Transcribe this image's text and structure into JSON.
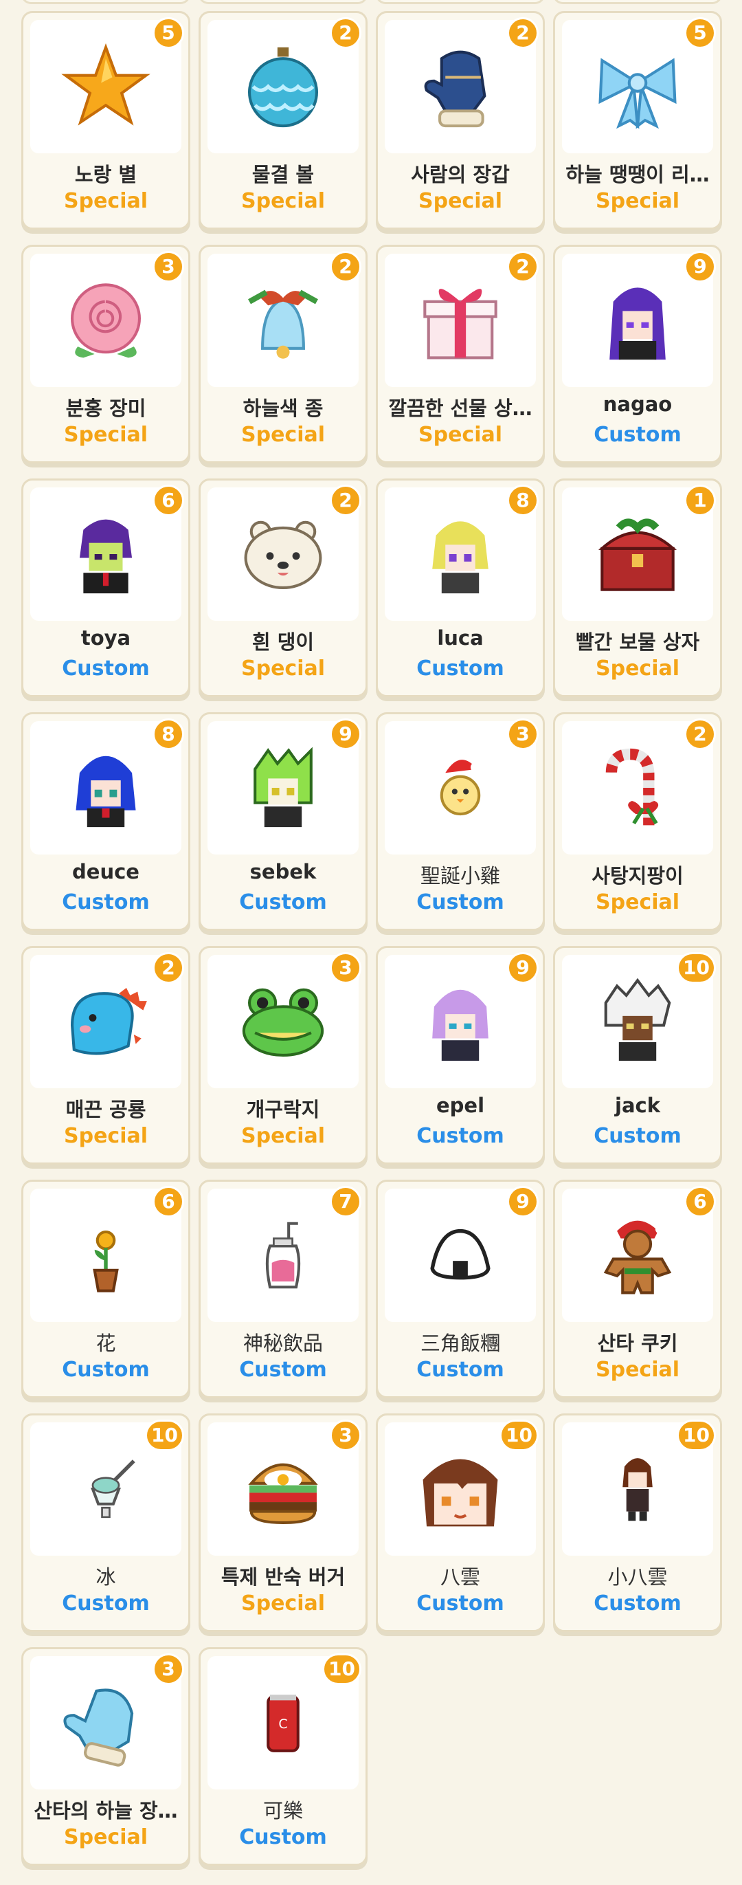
{
  "colors": {
    "special": "#f4a416",
    "custom": "#2a8ee8",
    "badge": "#f4a416",
    "background": "#f8f4e8"
  },
  "items": [
    {
      "name": "노랑 별",
      "type": "Special",
      "count": "5",
      "icon": "yellow-star-icon",
      "light": false
    },
    {
      "name": "물결 볼",
      "type": "Special",
      "count": "2",
      "icon": "blue-ornament-icon",
      "light": false
    },
    {
      "name": "사람의 장갑",
      "type": "Special",
      "count": "2",
      "icon": "blue-mitten-icon",
      "light": false
    },
    {
      "name": "하늘 땡땡이 리…",
      "type": "Special",
      "count": "5",
      "icon": "blue-ribbon-icon",
      "light": false
    },
    {
      "name": "분홍 장미",
      "type": "Special",
      "count": "3",
      "icon": "pink-rose-icon",
      "light": false
    },
    {
      "name": "하늘색 종",
      "type": "Special",
      "count": "2",
      "icon": "sky-bell-icon",
      "light": false
    },
    {
      "name": "깔끔한 선물 상…",
      "type": "Special",
      "count": "2",
      "icon": "gift-box-icon",
      "light": false
    },
    {
      "name": "nagao",
      "type": "Custom",
      "count": "9",
      "icon": "purple-hair-character-icon",
      "light": false
    },
    {
      "name": "toya",
      "type": "Custom",
      "count": "6",
      "icon": "toya-character-icon",
      "light": false
    },
    {
      "name": "흰 댕이",
      "type": "Special",
      "count": "2",
      "icon": "white-bear-icon",
      "light": false
    },
    {
      "name": "luca",
      "type": "Custom",
      "count": "8",
      "icon": "blonde-character-icon",
      "light": false
    },
    {
      "name": "빨간 보물 상자",
      "type": "Special",
      "count": "1",
      "icon": "red-treasure-chest-icon",
      "light": false
    },
    {
      "name": "deuce",
      "type": "Custom",
      "count": "8",
      "icon": "blue-hair-character-icon",
      "light": false
    },
    {
      "name": "sebek",
      "type": "Custom",
      "count": "9",
      "icon": "green-hair-character-icon",
      "light": false
    },
    {
      "name": "聖誕小雞",
      "type": "Custom",
      "count": "3",
      "icon": "christmas-chick-icon",
      "light": true
    },
    {
      "name": "사탕지팡이",
      "type": "Special",
      "count": "2",
      "icon": "candy-cane-icon",
      "light": false
    },
    {
      "name": "매끈 공룡",
      "type": "Special",
      "count": "2",
      "icon": "blue-dinosaur-icon",
      "light": false
    },
    {
      "name": "개구락지",
      "type": "Special",
      "count": "3",
      "icon": "frog-icon",
      "light": false
    },
    {
      "name": "epel",
      "type": "Custom",
      "count": "9",
      "icon": "lavender-hair-character-icon",
      "light": false
    },
    {
      "name": "jack",
      "type": "Custom",
      "count": "10",
      "icon": "white-hair-character-icon",
      "light": false
    },
    {
      "name": "花",
      "type": "Custom",
      "count": "6",
      "icon": "potted-flower-icon",
      "light": true
    },
    {
      "name": "神秘飲品",
      "type": "Custom",
      "count": "7",
      "icon": "mystery-drink-icon",
      "light": true
    },
    {
      "name": "三角飯糰",
      "type": "Custom",
      "count": "9",
      "icon": "onigiri-icon",
      "light": true
    },
    {
      "name": "산타 쿠키",
      "type": "Special",
      "count": "6",
      "icon": "gingerbread-santa-icon",
      "light": false
    },
    {
      "name": "冰",
      "type": "Custom",
      "count": "10",
      "icon": "ice-cream-cup-icon",
      "light": true
    },
    {
      "name": "특제 반숙 버거",
      "type": "Special",
      "count": "3",
      "icon": "burger-icon",
      "light": false
    },
    {
      "name": "八雲",
      "type": "Custom",
      "count": "10",
      "icon": "brown-hair-face-icon",
      "light": true
    },
    {
      "name": "小八雲",
      "type": "Custom",
      "count": "10",
      "icon": "small-character-icon",
      "light": true
    },
    {
      "name": "산타의 하늘 장…",
      "type": "Special",
      "count": "3",
      "icon": "sky-mitten-icon",
      "light": false
    },
    {
      "name": "可樂",
      "type": "Custom",
      "count": "10",
      "icon": "cola-can-icon",
      "light": true
    }
  ]
}
